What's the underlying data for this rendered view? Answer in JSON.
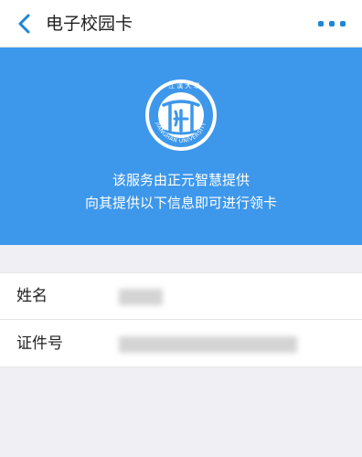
{
  "nav": {
    "back_icon": "chevron-left-icon",
    "title": "电子校园卡",
    "more_icon": "more-dots-icon",
    "accent_color": "#1f85d6"
  },
  "banner": {
    "background_color": "#3d97eb",
    "logo_icon": "university-seal-logo",
    "logo_text": "JIANGHAN UNIVERSITY",
    "line1": "该服务由正元智慧提供",
    "line2": "向其提供以下信息即可进行领卡"
  },
  "form": {
    "fields": [
      {
        "label": "姓名",
        "value": ""
      },
      {
        "label": "证件号",
        "value": ""
      }
    ]
  }
}
